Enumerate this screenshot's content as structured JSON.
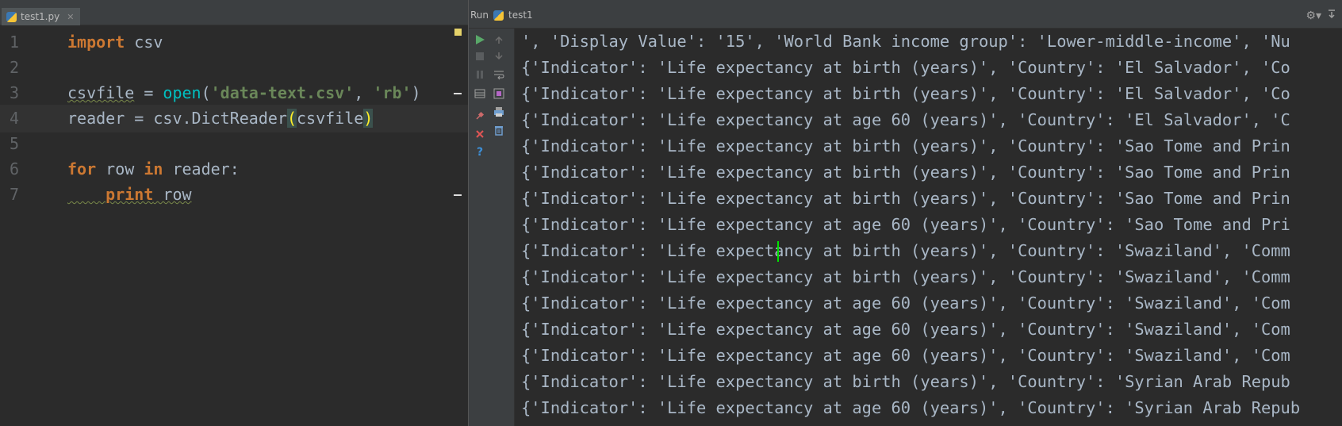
{
  "editor": {
    "tab_label": "test1.py",
    "lines": [
      {
        "num": "1"
      },
      {
        "num": "2"
      },
      {
        "num": "3"
      },
      {
        "num": "4"
      },
      {
        "num": "5"
      },
      {
        "num": "6"
      },
      {
        "num": "7"
      }
    ],
    "tokens": {
      "import": "import",
      "csv": " csv",
      "csvfile": "csvfile",
      "assign": " = ",
      "open": "open",
      "lparen": "(",
      "str1": "'data-text.csv'",
      "comma": ", ",
      "str2": "'rb'",
      "rparen": ")",
      "reader_assign": "reader = csv.DictReader",
      "lparen2": "(",
      "csvfile_arg": "csvfile",
      "rparen2": ")",
      "for": "for",
      "row": " row ",
      "in": "in",
      "reader_colon": " reader:",
      "indent": "    ",
      "print": "print",
      "print_arg": " row"
    }
  },
  "run": {
    "header_label": "Run",
    "config_name": "test1",
    "output": [
      "', 'Display Value': '15', 'World Bank income group': 'Lower-middle-income', 'Nu",
      "{'Indicator': 'Life expectancy at birth (years)', 'Country': 'El Salvador', 'Co",
      "{'Indicator': 'Life expectancy at birth (years)', 'Country': 'El Salvador', 'Co",
      "{'Indicator': 'Life expectancy at age 60 (years)', 'Country': 'El Salvador', 'C",
      "{'Indicator': 'Life expectancy at birth (years)', 'Country': 'Sao Tome and Prin",
      "{'Indicator': 'Life expectancy at birth (years)', 'Country': 'Sao Tome and Prin",
      "{'Indicator': 'Life expectancy at birth (years)', 'Country': 'Sao Tome and Prin",
      "{'Indicator': 'Life expectancy at age 60 (years)', 'Country': 'Sao Tome and Pri",
      "{'Indicator': 'Life expectancy at birth (years)', 'Country': 'Swaziland', 'Comm",
      "{'Indicator': 'Life expectancy at birth (years)', 'Country': 'Swaziland', 'Comm",
      "{'Indicator': 'Life expectancy at age 60 (years)', 'Country': 'Swaziland', 'Com",
      "{'Indicator': 'Life expectancy at age 60 (years)', 'Country': 'Swaziland', 'Com",
      "{'Indicator': 'Life expectancy at age 60 (years)', 'Country': 'Swaziland', 'Com",
      "{'Indicator': 'Life expectancy at birth (years)', 'Country': 'Syrian Arab Repub",
      "{'Indicator': 'Life expectancy at age 60 (years)', 'Country': 'Syrian Arab Repub"
    ]
  },
  "icons": {
    "python_file": "python-file-icon",
    "run_tool": "run-tool-icon",
    "rerun": "rerun-icon",
    "stop": "stop-icon",
    "pause": "pause-icon",
    "soft_wrap": "soft-wrap-icon",
    "scroll_to_end": "scroll-to-end-icon",
    "print": "print-icon",
    "clear": "trash-icon",
    "pin": "pin-icon",
    "close": "close-icon",
    "help": "help-icon",
    "settings": "gear-icon",
    "hide": "hide-icon"
  },
  "colors": {
    "keyword": "#cc7832",
    "string": "#6a8759",
    "builtin": "#00c0c0",
    "run_green": "#59a869",
    "close_red": "#e05555",
    "help_blue": "#3d8fd6"
  }
}
